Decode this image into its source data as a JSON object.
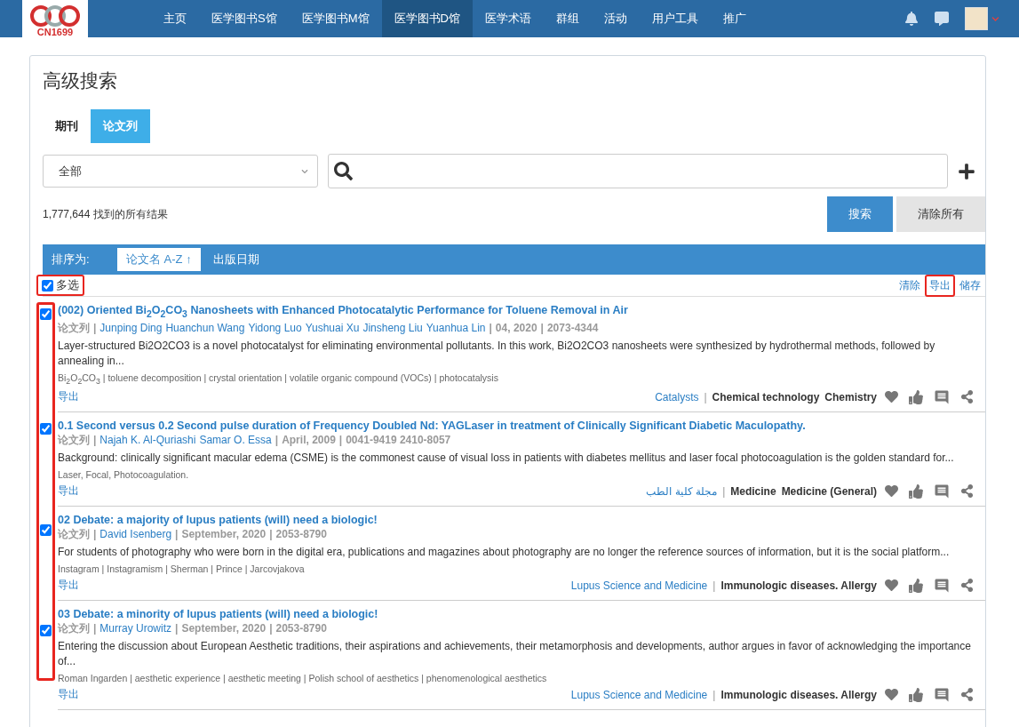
{
  "nav": {
    "logo_text": "CN1699",
    "items": [
      {
        "label": "主页",
        "selected": false
      },
      {
        "label": "医学图书S馆",
        "selected": false
      },
      {
        "label": "医学图书M馆",
        "selected": false
      },
      {
        "label": "医学图书D馆",
        "selected": true
      },
      {
        "label": "医学术语",
        "selected": false
      },
      {
        "label": "群组",
        "selected": false
      },
      {
        "label": "活动",
        "selected": false
      },
      {
        "label": "用户工具",
        "selected": false
      },
      {
        "label": "推广",
        "selected": false
      }
    ]
  },
  "page_title": "高级搜索",
  "tabs": [
    {
      "label": "期刊",
      "selected": false
    },
    {
      "label": "论文列",
      "selected": true
    }
  ],
  "scope_select": {
    "value": "全部"
  },
  "result_count": "1,777,644 找到的所有结果",
  "buttons": {
    "search": "搜索",
    "clear_all": "清除所有"
  },
  "sort": {
    "label": "排序为:",
    "options": [
      {
        "label": "论文名 A-Z",
        "arrow": "↑",
        "selected": true
      },
      {
        "label": "出版日期",
        "selected": false
      }
    ]
  },
  "multi_select": {
    "label": "多选",
    "checked": true,
    "highlighted": true
  },
  "actions": [
    {
      "label": "清除",
      "highlighted": false
    },
    {
      "label": "导出",
      "highlighted": true
    },
    {
      "label": "储存",
      "highlighted": false
    }
  ],
  "checkbox_column_highlighted": true,
  "results": [
    {
      "checked": true,
      "title": "(002) Oriented Bi$_{2}$O$_{2}$CO$_{3}$ Nanosheets with Enhanced Photocatalytic Performance for Toluene Removal in Air",
      "meta": [
        {
          "kind": "type",
          "text": "论文列"
        },
        {
          "kind": "sep",
          "text": "|"
        },
        {
          "kind": "author",
          "text": "Junping Ding"
        },
        {
          "kind": "author",
          "text": "Huanchun Wang"
        },
        {
          "kind": "author",
          "text": "Yidong Luo"
        },
        {
          "kind": "author",
          "text": "Yushuai Xu"
        },
        {
          "kind": "author",
          "text": "Jinsheng Liu"
        },
        {
          "kind": "author",
          "text": "Yuanhua Lin"
        },
        {
          "kind": "sep",
          "text": "|"
        },
        {
          "kind": "date",
          "text": "04, 2020"
        },
        {
          "kind": "sep",
          "text": "|"
        },
        {
          "kind": "issn",
          "text": "2073-4344"
        }
      ],
      "abstract": "Layer-structured Bi2O2CO3 is a novel photocatalyst for eliminating environmental pollutants. In this work, Bi2O2CO3 nanosheets were synthesized by hydrothermal methods, followed by annealing in...",
      "keywords": "Bi$_{2}$O$_{2}$CO$_{3}$ | toluene decomposition | crystal orientation | volatile organic compound (VOCs) | photocatalysis",
      "export": "导出",
      "subjects": [
        {
          "kind": "journal",
          "text": "Catalysts"
        },
        {
          "kind": "sep",
          "text": "|"
        },
        {
          "kind": "subject",
          "text": "Chemical technology"
        },
        {
          "kind": "subject",
          "text": "Chemistry"
        }
      ]
    },
    {
      "checked": true,
      "title": "0.1 Second versus 0.2 Second pulse duration of Frequency Doubled Nd: YAGLaser in treatment of Clinically Significant Diabetic Maculopathy.",
      "meta": [
        {
          "kind": "type",
          "text": "论文列"
        },
        {
          "kind": "sep",
          "text": "|"
        },
        {
          "kind": "author",
          "text": "Najah K. Al-Quriashi"
        },
        {
          "kind": "author",
          "text": "Samar O. Essa"
        },
        {
          "kind": "sep",
          "text": "|"
        },
        {
          "kind": "date",
          "text": "April, 2009"
        },
        {
          "kind": "sep",
          "text": "|"
        },
        {
          "kind": "issn",
          "text": "0041-9419 2410-8057"
        }
      ],
      "abstract": "Background: clinically significant macular edema (CSME) is the commonest cause of visual loss in patients with diabetes mellitus and laser focal photocoagulation is the golden standard for...",
      "keywords": "Laser, Focal, Photocoagulation.",
      "export": "导出",
      "subjects": [
        {
          "kind": "journal",
          "text": "مجلة كلية الطب"
        },
        {
          "kind": "sep",
          "text": "|"
        },
        {
          "kind": "subject",
          "text": "Medicine"
        },
        {
          "kind": "subject",
          "text": "Medicine (General)"
        }
      ]
    },
    {
      "checked": true,
      "title": "02 Debate: a majority of lupus patients (will) need a biologic!",
      "meta": [
        {
          "kind": "type",
          "text": "论文列"
        },
        {
          "kind": "sep",
          "text": "|"
        },
        {
          "kind": "author",
          "text": "David Isenberg"
        },
        {
          "kind": "sep",
          "text": "|"
        },
        {
          "kind": "date",
          "text": "September, 2020"
        },
        {
          "kind": "sep",
          "text": "|"
        },
        {
          "kind": "issn",
          "text": "2053-8790"
        }
      ],
      "abstract": "For students of photography who were born in the digital era, publications and magazines about photography are no longer the reference sources of information, but it is the social platform...",
      "keywords": "Instagram | Instagramism | Sherman | Prince | Jarcovjakova",
      "export": "导出",
      "subjects": [
        {
          "kind": "journal",
          "text": "Lupus Science and Medicine"
        },
        {
          "kind": "sep",
          "text": "|"
        },
        {
          "kind": "subject",
          "text": "Immunologic diseases. Allergy"
        }
      ]
    },
    {
      "checked": true,
      "title": "03 Debate: a minority of lupus patients (will) need a biologic!",
      "meta": [
        {
          "kind": "type",
          "text": "论文列"
        },
        {
          "kind": "sep",
          "text": "|"
        },
        {
          "kind": "author",
          "text": "Murray Urowitz"
        },
        {
          "kind": "sep",
          "text": "|"
        },
        {
          "kind": "date",
          "text": "September, 2020"
        },
        {
          "kind": "sep",
          "text": "|"
        },
        {
          "kind": "issn",
          "text": "2053-8790"
        }
      ],
      "abstract": "Entering the discussion about European Aesthetic traditions, their aspirations and achievements, their metamorphosis and developments, author argues in favor of acknowledging the importance of...",
      "keywords": "Roman Ingarden | aesthetic experience | aesthetic meeting | Polish school of aesthetics | phenomenological aesthetics",
      "export": "导出",
      "subjects": [
        {
          "kind": "journal",
          "text": "Lupus Science and Medicine"
        },
        {
          "kind": "sep",
          "text": "|"
        },
        {
          "kind": "subject",
          "text": "Immunologic diseases. Allergy"
        }
      ]
    }
  ]
}
